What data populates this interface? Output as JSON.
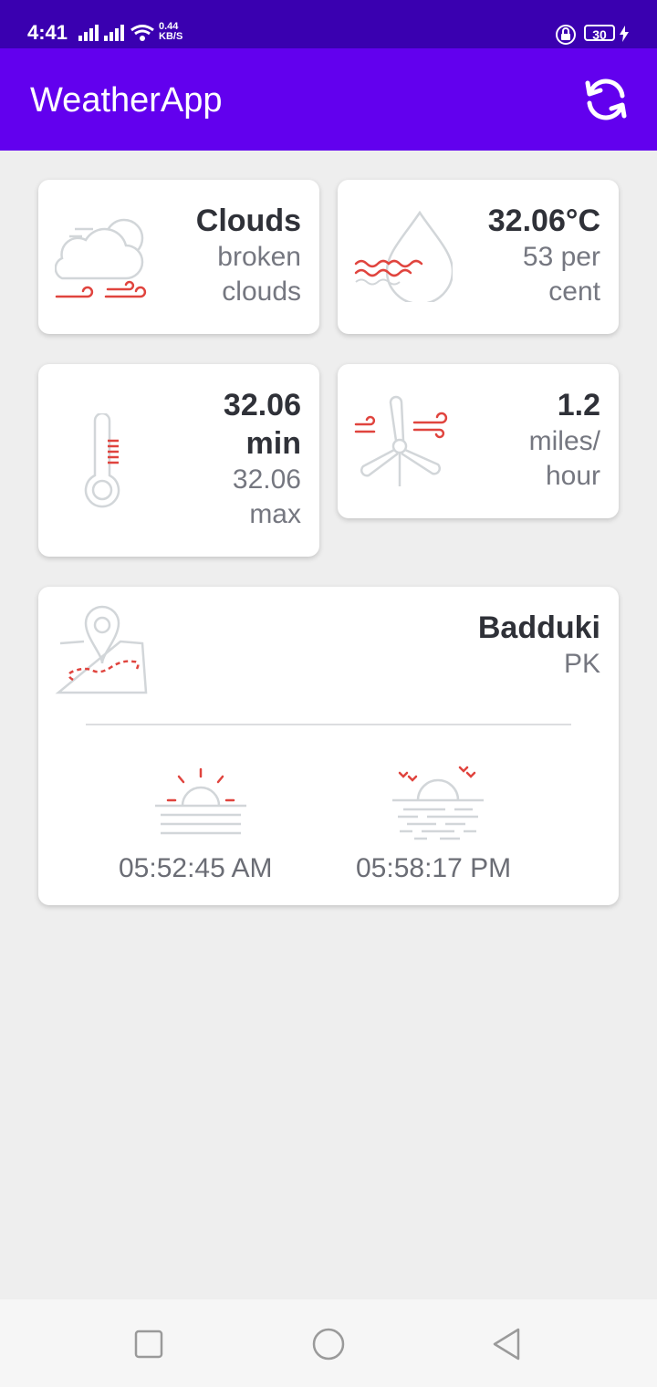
{
  "status": {
    "time": "4:41",
    "net_speed_value": "0.44",
    "net_speed_unit": "KB/S",
    "battery": "30"
  },
  "app": {
    "title": "WeatherApp"
  },
  "weather": {
    "condition": "Clouds",
    "description_line1": "broken",
    "description_line2": "clouds"
  },
  "humidity": {
    "temperature": "32.06°C",
    "line1": "53 per",
    "line2": "cent"
  },
  "temperature": {
    "min_value": "32.06",
    "min_label": "min",
    "max_value": "32.06",
    "max_label": "max"
  },
  "wind": {
    "speed": "1.2",
    "unit_line1": "miles/",
    "unit_line2": "hour"
  },
  "location": {
    "city": "Badduki",
    "country": "PK",
    "sunrise": "05:52:45 AM",
    "sunset": "05:58:17 PM"
  },
  "colors": {
    "status_bar": "#3a00b0",
    "app_bar": "#6200ee",
    "accent_red": "#e0443e",
    "icon_gray": "#cfd3d6"
  }
}
